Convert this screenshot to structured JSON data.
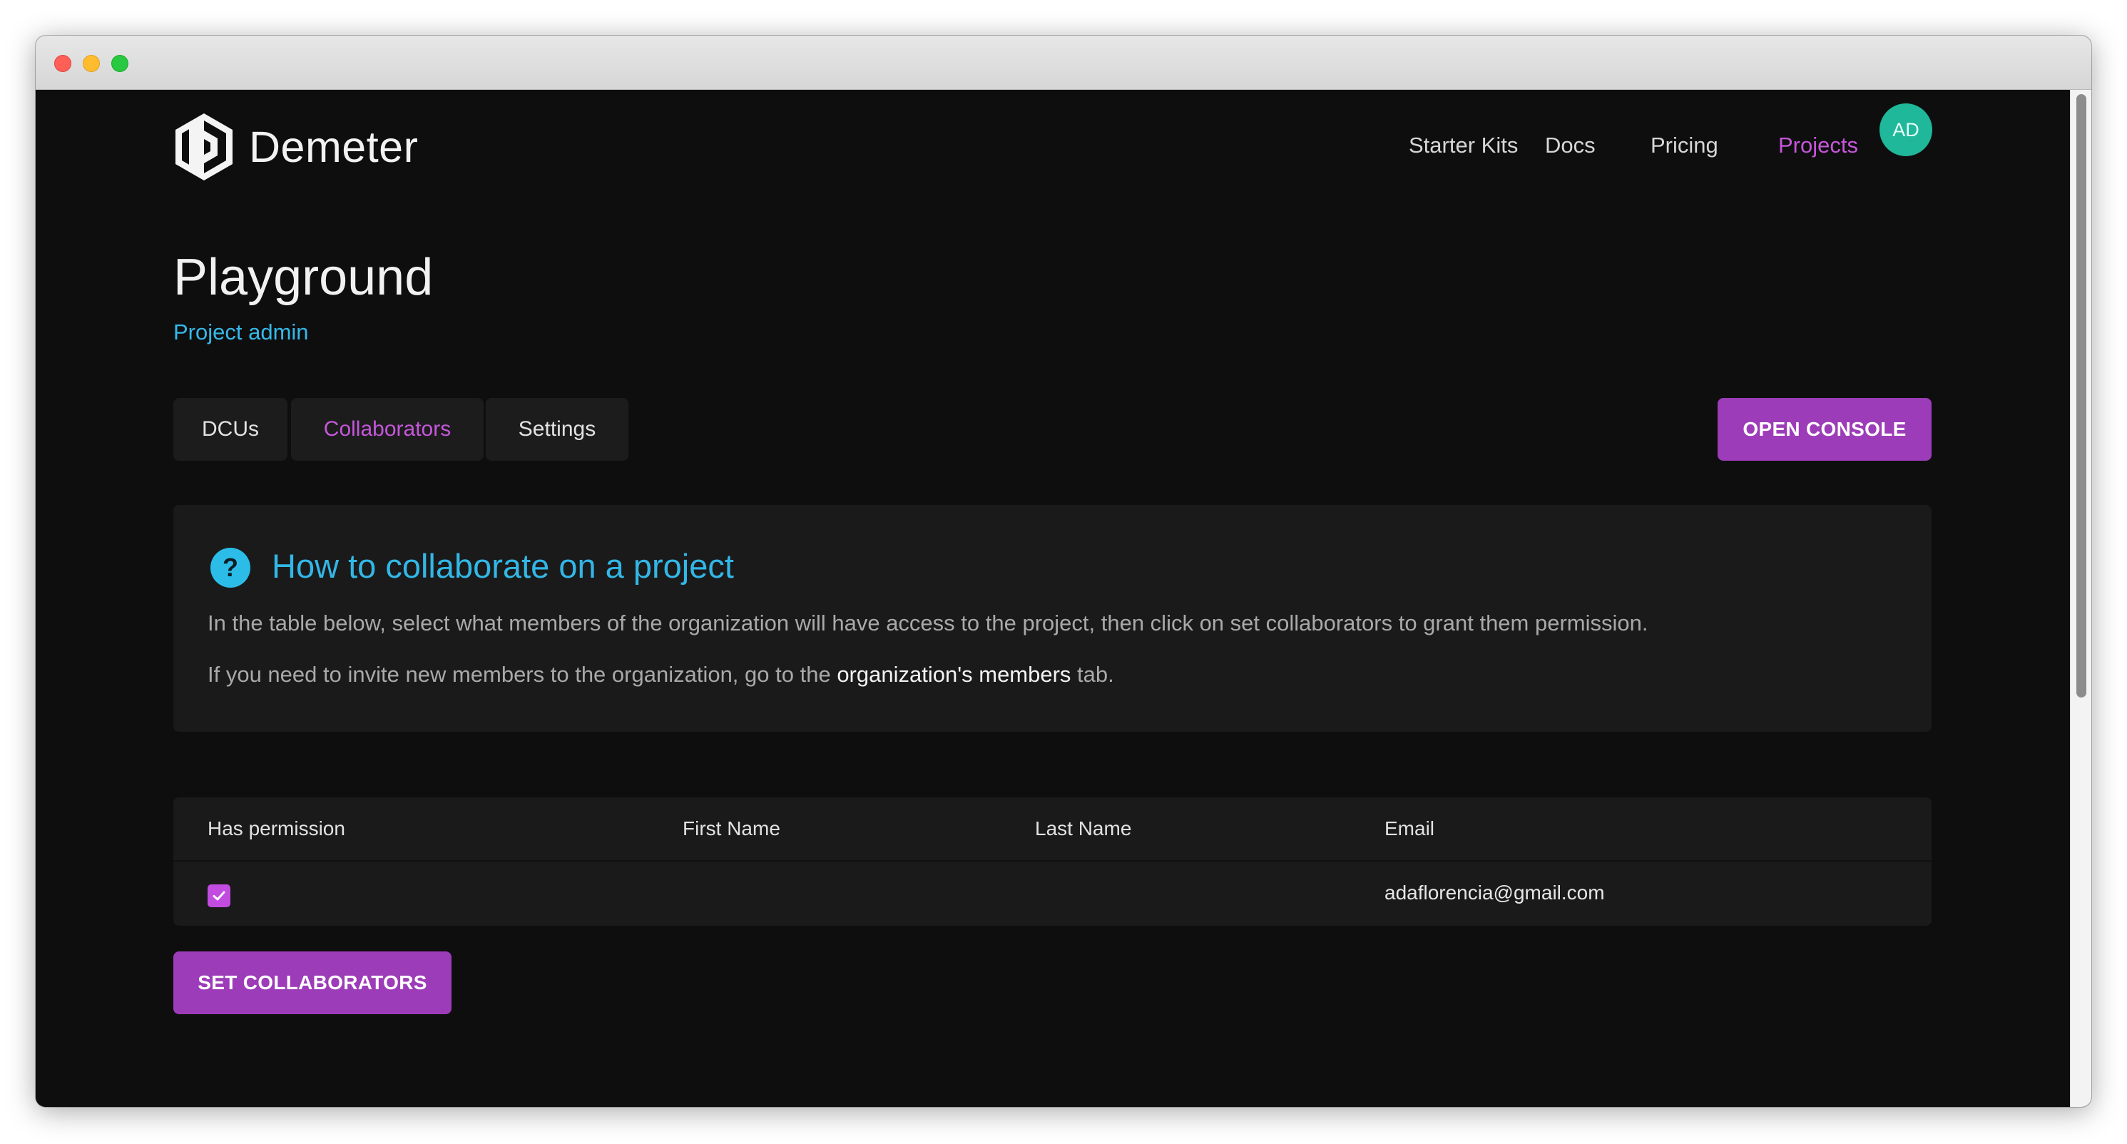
{
  "app": {
    "name": "Demeter"
  },
  "nav": {
    "items": [
      {
        "label": "Starter Kits"
      },
      {
        "label": "Docs"
      },
      {
        "label": "Pricing"
      },
      {
        "label": "Projects"
      }
    ],
    "avatar_initials": "AD"
  },
  "page": {
    "title": "Playground",
    "subtitle": "Project admin"
  },
  "tabs": [
    {
      "label": "DCUs"
    },
    {
      "label": "Collaborators"
    },
    {
      "label": "Settings"
    }
  ],
  "actions": {
    "open_console": "OPEN CONSOLE",
    "set_collaborators": "SET COLLABORATORS"
  },
  "info": {
    "icon": "question-circle-icon",
    "title": "How to collaborate on a project",
    "paragraph1": "In the table below, select what members of the organization will have access to the project, then click on set collaborators to grant them permission.",
    "paragraph2_before": "If you need to invite new members to the organization, go to the ",
    "paragraph2_link": "organization's members",
    "paragraph2_after": " tab."
  },
  "table": {
    "columns": [
      "Has permission",
      "First Name",
      "Last Name",
      "Email"
    ],
    "rows": [
      {
        "has_permission": true,
        "first_name": "",
        "last_name": "",
        "email": "adaflorencia@gmail.com"
      }
    ]
  },
  "colors": {
    "accent": "#9d3cb8",
    "link": "#36b9e8",
    "active_nav": "#c557d9",
    "avatar": "#1fb89a"
  }
}
